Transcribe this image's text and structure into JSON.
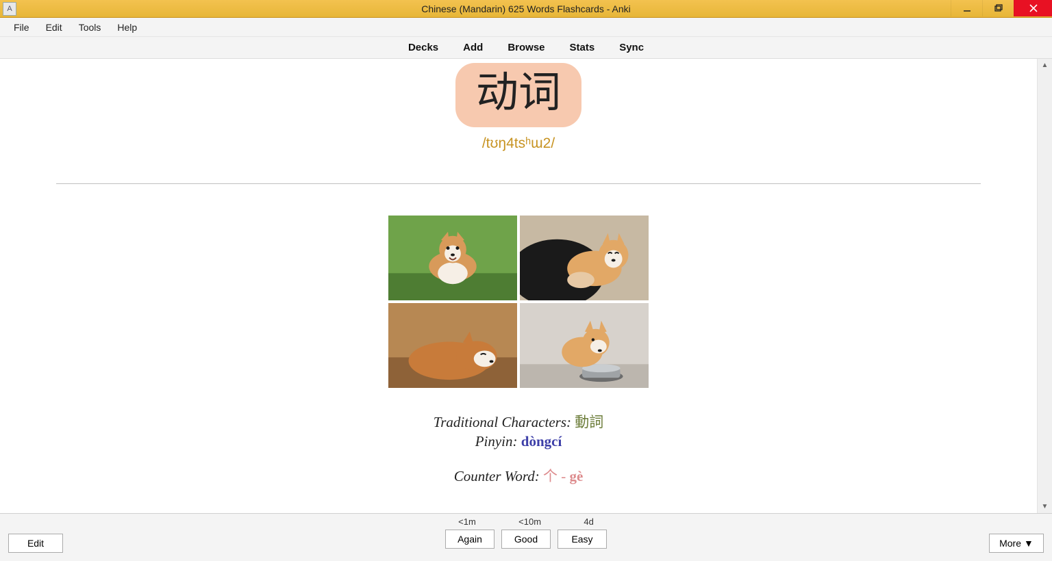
{
  "titlebar": {
    "title": "Chinese (Mandarin) 625 Words Flashcards - Anki",
    "icon_glyph": "A"
  },
  "menubar": {
    "items": [
      "File",
      "Edit",
      "Tools",
      "Help"
    ]
  },
  "toolbar": {
    "items": [
      "Decks",
      "Add",
      "Browse",
      "Stats",
      "Sync"
    ]
  },
  "card": {
    "word": "动词",
    "ipa": "/tʊŋ4tsʰɯ2/",
    "trad_label": "Traditional Characters: ",
    "trad_chars": "動詞",
    "pinyin_label": "Pinyin: ",
    "pinyin": "dòngcí",
    "counter_label": "Counter Word: ",
    "counter_char": "个",
    "counter_dash": " - ",
    "counter_pinyin": "gè",
    "images": [
      "corgi-running",
      "corgi-held",
      "corgi-sleeping",
      "corgi-eating"
    ]
  },
  "footer": {
    "edit": "Edit",
    "more": "More",
    "times": [
      "<1m",
      "<10m",
      "4d"
    ],
    "buttons": [
      "Again",
      "Good",
      "Easy"
    ]
  }
}
